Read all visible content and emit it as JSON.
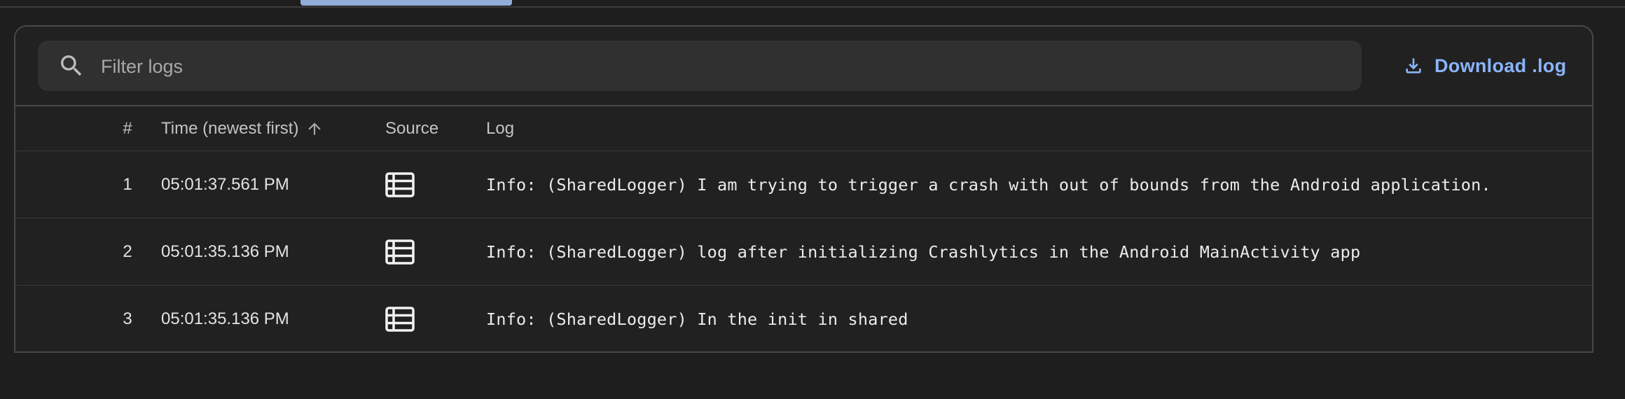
{
  "search": {
    "placeholder": "Filter logs"
  },
  "toolbar": {
    "download_label": "Download .log"
  },
  "table": {
    "headers": {
      "num": "#",
      "time": "Time (newest first)",
      "source": "Source",
      "log": "Log"
    },
    "rows": [
      {
        "num": "1",
        "time": "05:01:37.561 PM",
        "source_icon": "list-icon",
        "log": "Info: (SharedLogger) I am trying to trigger a crash with out of bounds from the Android application."
      },
      {
        "num": "2",
        "time": "05:01:35.136 PM",
        "source_icon": "list-icon",
        "log": "Info: (SharedLogger) log after initializing Crashlytics in the Android MainActivity app"
      },
      {
        "num": "3",
        "time": "05:01:35.136 PM",
        "source_icon": "list-icon",
        "log": "Info: (SharedLogger) In the init in shared"
      }
    ]
  },
  "colors": {
    "background": "#1e1e1f",
    "panel": "#212122",
    "search_bg": "#303031",
    "accent": "#8ab4f8",
    "tab_indicator": "#a8c7fa"
  }
}
